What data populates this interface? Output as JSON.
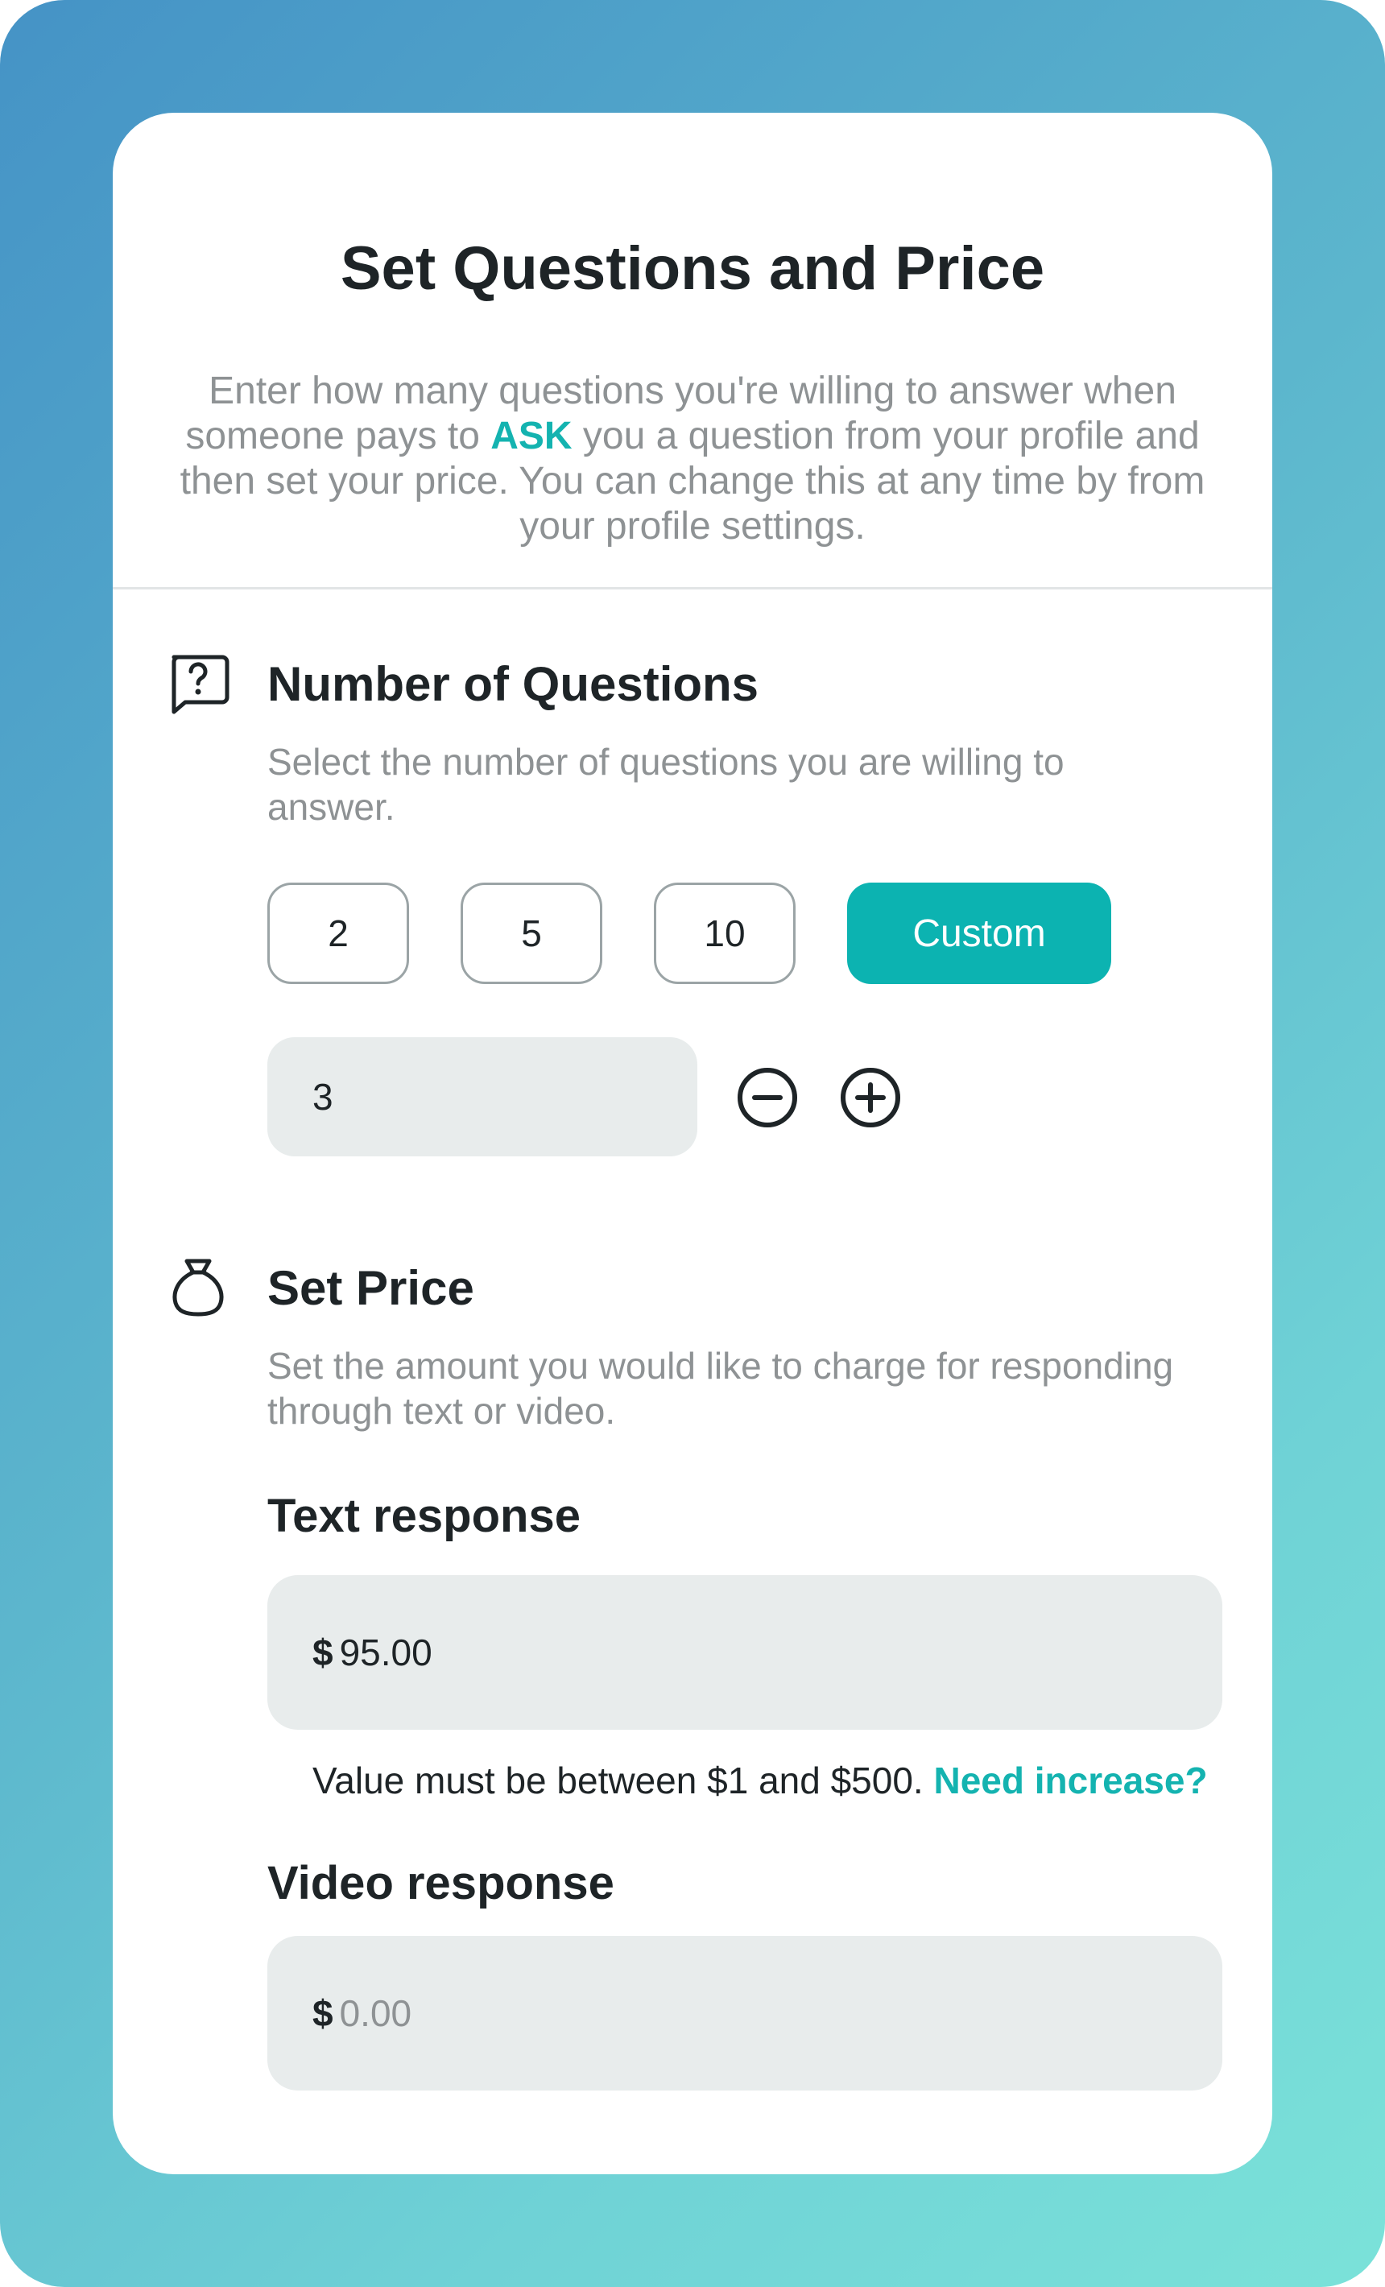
{
  "header": {
    "title": "Set Questions and Price",
    "intro_before": "Enter how many questions you're willing to answer when someone pays to ",
    "intro_ask": "ASK",
    "intro_after": " you a question from your profile and then set your price. You can change this at any time by from your profile settings."
  },
  "questions": {
    "icon": "question-bubble-icon",
    "title": "Number of Questions",
    "description": "Select the number of questions you are willing to answer.",
    "options": [
      "2",
      "5",
      "10"
    ],
    "custom_label": "Custom",
    "custom_selected": true,
    "custom_value": "3"
  },
  "price": {
    "icon": "money-bag-icon",
    "title": "Set Price",
    "description": "Set the amount you would like to charge for responding through text or video.",
    "text_response": {
      "label": "Text response",
      "currency": "$",
      "value": "95.00"
    },
    "hint_text": "Value must be between $1 and $500.",
    "hint_link": "Need increase?",
    "video_response": {
      "label": "Video response",
      "currency": "$",
      "placeholder": "0.00"
    }
  },
  "colors": {
    "accent": "#0cb3b1",
    "field_bg": "#e8ecec",
    "text_dark": "#1e2427",
    "text_muted": "#8e9294"
  }
}
